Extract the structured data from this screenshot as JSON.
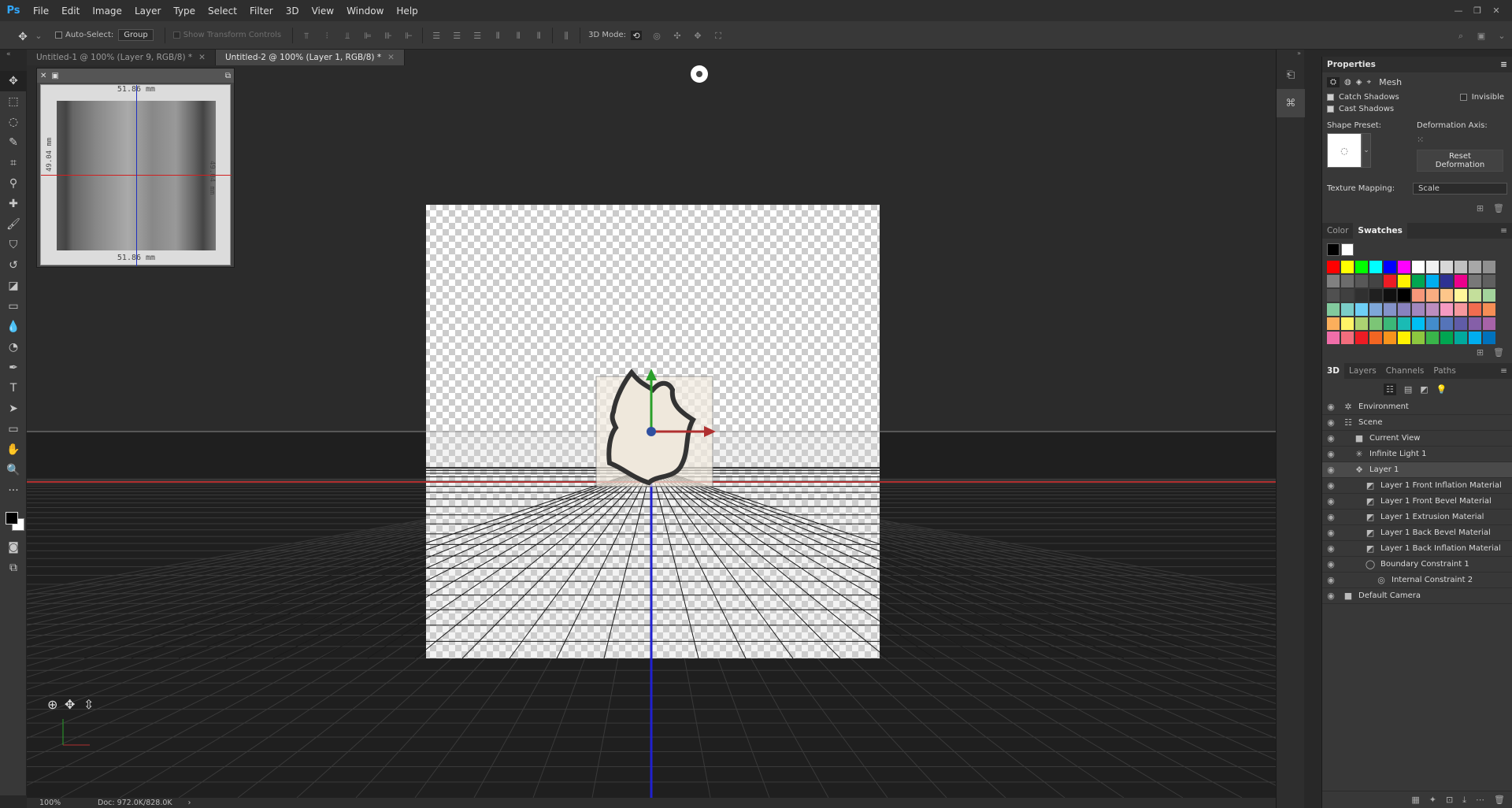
{
  "menu": {
    "logo": "Ps",
    "items": [
      "File",
      "Edit",
      "Image",
      "Layer",
      "Type",
      "Select",
      "Filter",
      "3D",
      "View",
      "Window",
      "Help"
    ]
  },
  "options_bar": {
    "auto_select_label": "Auto-Select:",
    "auto_select_value": "Group",
    "show_transform_label": "Show Transform Controls",
    "mode_label": "3D Mode:"
  },
  "tabs": [
    {
      "label": "Untitled-1 @ 100% (Layer 9, RGB/8) *",
      "active": false
    },
    {
      "label": "Untitled-2 @ 100% (Layer 1, RGB/8) *",
      "active": true
    }
  ],
  "mini_view": {
    "top_measure": "51.86 mm",
    "bottom_measure": "51.86 mm",
    "left_measure": "49.04 mm",
    "right_measure": "49.04 mm"
  },
  "status": {
    "zoom": "100%",
    "doc": "Doc: 972.0K/828.0K",
    "arrow": "›"
  },
  "properties": {
    "title": "Properties",
    "mode_label": "Mesh",
    "catch_shadows": "Catch Shadows",
    "cast_shadows": "Cast Shadows",
    "invisible": "Invisible",
    "shape_preset_label": "Shape Preset:",
    "deformation_axis_label": "Deformation Axis:",
    "reset_button": "Reset Deformation",
    "texture_mapping_label": "Texture Mapping:",
    "texture_mapping_value": "Scale"
  },
  "color_panel": {
    "tabs": [
      "Color",
      "Swatches"
    ],
    "swatches": [
      "#ff0000",
      "#ffff00",
      "#00ff00",
      "#00ffff",
      "#0000ff",
      "#ff00ff",
      "#ffffff",
      "#f0f0f0",
      "#d8d8d8",
      "#c0c0c0",
      "#a8a8a8",
      "#909090",
      "#808080",
      "#6c6c6c",
      "#585858",
      "#444444",
      "#ed1c24",
      "#fff200",
      "#00a651",
      "#00aeef",
      "#2e3192",
      "#ec008c",
      "#787878",
      "#606060",
      "#505050",
      "#404040",
      "#303030",
      "#202020",
      "#101010",
      "#000000",
      "#f7977a",
      "#f9ad81",
      "#fdc68a",
      "#fff79a",
      "#c4df9b",
      "#a3d39c",
      "#82ca9d",
      "#7bcdc8",
      "#6ecff6",
      "#7ea7d8",
      "#8493ca",
      "#8882be",
      "#a187be",
      "#bc8dbf",
      "#f49ac2",
      "#f6989d",
      "#f26c4f",
      "#f68e55",
      "#fbaf5c",
      "#fff467",
      "#acd372",
      "#7cc576",
      "#3bb878",
      "#1abbb4",
      "#00bff3",
      "#438ccb",
      "#5574b9",
      "#605ca8",
      "#855fa8",
      "#a763a8",
      "#f06ea9",
      "#f26d7d",
      "#ed1c24",
      "#f26522",
      "#f7941d",
      "#fff200",
      "#8dc73f",
      "#39b54a",
      "#00a651",
      "#00a99d",
      "#00aeef",
      "#0072bc"
    ]
  },
  "layers_panel": {
    "tabs": [
      "3D",
      "Layers",
      "Channels",
      "Paths"
    ],
    "rows": [
      {
        "label": "Environment",
        "indent": 0,
        "icon": "environment-icon",
        "glyph": "✲",
        "selected": false
      },
      {
        "label": "Scene",
        "indent": 0,
        "icon": "scene-icon",
        "glyph": "☷",
        "selected": false
      },
      {
        "label": "Current View",
        "indent": 1,
        "icon": "camera-icon",
        "glyph": "■",
        "selected": false
      },
      {
        "label": "Infinite Light 1",
        "indent": 1,
        "icon": "light-icon",
        "glyph": "✳",
        "selected": false
      },
      {
        "label": "Layer 1",
        "indent": 1,
        "icon": "mesh-icon",
        "glyph": "❖",
        "selected": true
      },
      {
        "label": "Layer 1 Front Inflation Material",
        "indent": 2,
        "icon": "material-icon",
        "glyph": "◩",
        "selected": false
      },
      {
        "label": "Layer 1 Front Bevel Material",
        "indent": 2,
        "icon": "material-icon",
        "glyph": "◩",
        "selected": false
      },
      {
        "label": "Layer 1 Extrusion Material",
        "indent": 2,
        "icon": "material-icon",
        "glyph": "◩",
        "selected": false
      },
      {
        "label": "Layer 1 Back Bevel Material",
        "indent": 2,
        "icon": "material-icon",
        "glyph": "◩",
        "selected": false
      },
      {
        "label": "Layer 1 Back Inflation Material",
        "indent": 2,
        "icon": "material-icon",
        "glyph": "◩",
        "selected": false
      },
      {
        "label": "Boundary Constraint 1",
        "indent": 2,
        "icon": "constraint-icon",
        "glyph": "◯",
        "selected": false
      },
      {
        "label": "Internal Constraint 2",
        "indent": 3,
        "icon": "constraint-icon",
        "glyph": "◎",
        "selected": false
      },
      {
        "label": "Default Camera",
        "indent": 0,
        "icon": "camera-icon",
        "glyph": "■",
        "selected": false
      }
    ]
  },
  "toolbar": {
    "tools": [
      {
        "name": "move-tool-icon",
        "glyph": "✥"
      },
      {
        "name": "marquee-tool-icon",
        "glyph": "⬚"
      },
      {
        "name": "lasso-tool-icon",
        "glyph": "◌"
      },
      {
        "name": "quick-select-tool-icon",
        "glyph": "✎"
      },
      {
        "name": "crop-tool-icon",
        "glyph": "⌗"
      },
      {
        "name": "eyedropper-tool-icon",
        "glyph": "⚲"
      },
      {
        "name": "healing-tool-icon",
        "glyph": "✚"
      },
      {
        "name": "brush-tool-icon",
        "glyph": "🖌"
      },
      {
        "name": "stamp-tool-icon",
        "glyph": "⛉"
      },
      {
        "name": "history-brush-tool-icon",
        "glyph": "↺"
      },
      {
        "name": "eraser-tool-icon",
        "glyph": "◪"
      },
      {
        "name": "gradient-tool-icon",
        "glyph": "▭"
      },
      {
        "name": "blur-tool-icon",
        "glyph": "💧"
      },
      {
        "name": "dodge-tool-icon",
        "glyph": "◔"
      },
      {
        "name": "pen-tool-icon",
        "glyph": "✒"
      },
      {
        "name": "type-tool-icon",
        "glyph": "T"
      },
      {
        "name": "path-select-tool-icon",
        "glyph": "➤"
      },
      {
        "name": "rectangle-tool-icon",
        "glyph": "▭"
      },
      {
        "name": "hand-tool-icon",
        "glyph": "✋"
      },
      {
        "name": "zoom-tool-icon",
        "glyph": "🔍"
      },
      {
        "name": "more-tools-icon",
        "glyph": "···"
      }
    ]
  }
}
